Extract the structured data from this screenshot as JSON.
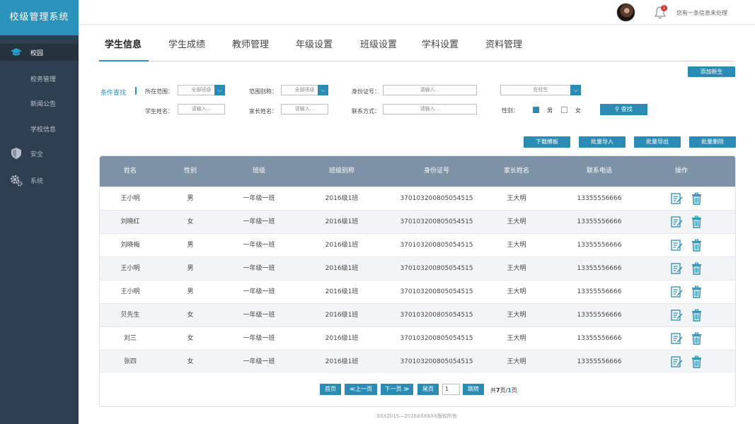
{
  "app": {
    "title": "校级管理系统"
  },
  "sidebar": {
    "items": [
      {
        "label": "校园",
        "icon": "graduation-cap-icon",
        "active": true
      },
      {
        "label": "校务管理"
      },
      {
        "label": "新闻公告"
      },
      {
        "label": "学校信息"
      },
      {
        "label": "安全",
        "icon": "shield-icon"
      },
      {
        "label": "系统",
        "icon": "gears-icon"
      }
    ]
  },
  "topbar": {
    "notification_count": "1",
    "notice_text": "您有一条信息未处理"
  },
  "tabs": [
    {
      "label": "学生信息",
      "active": true
    },
    {
      "label": "学生成绩"
    },
    {
      "label": "教师管理"
    },
    {
      "label": "年级设置"
    },
    {
      "label": "班级设置"
    },
    {
      "label": "学科设置"
    },
    {
      "label": "资料管理"
    }
  ],
  "add_button": "添加新生",
  "filters": {
    "title": "条件查找",
    "range_label": "所在范围：",
    "range_value": "全部班级",
    "alias_label": "范围别称：",
    "alias_value": "全部班级",
    "id_label": "身份证号：",
    "id_placeholder": "请输入...",
    "status_value": "在校生",
    "student_label": "学生姓名：",
    "student_placeholder": "请输入...",
    "parent_label": "家长姓名：",
    "parent_placeholder": "请输入...",
    "contact_label": "联系方式：",
    "contact_placeholder": "请输入...",
    "gender_label": "性别：",
    "gender_male": "男",
    "gender_female": "女",
    "search_button": "查找"
  },
  "actions": {
    "download": "下载模板",
    "import": "批量导入",
    "export": "批量导出",
    "delete": "批量删除"
  },
  "table": {
    "headers": [
      "姓名",
      "性别",
      "班级",
      "班级别称",
      "身份证号",
      "家长姓名",
      "联系电话",
      "操作"
    ],
    "rows": [
      [
        "王小明",
        "男",
        "一年级一班",
        "2016级1班",
        "370103200805054515",
        "王大明",
        "13355556666"
      ],
      [
        "刘晓红",
        "女",
        "一年级一班",
        "2016级1班",
        "370103200805054515",
        "王大明",
        "13355556666"
      ],
      [
        "刘晓梅",
        "男",
        "一年级一班",
        "2016级1班",
        "370103200805054515",
        "王大明",
        "13355556666"
      ],
      [
        "王小明",
        "男",
        "一年级一班",
        "2016级1班",
        "370103200805054515",
        "王大明",
        "13355556666"
      ],
      [
        "王小明",
        "男",
        "一年级一班",
        "2016级1班",
        "370103200805054515",
        "王大明",
        "13355556666"
      ],
      [
        "贝先生",
        "女",
        "一年级一班",
        "2016级1班",
        "370103200805054515",
        "王大明",
        "13355556666"
      ],
      [
        "刘三",
        "女",
        "一年级一班",
        "2016级1班",
        "370103200805054515",
        "王大明",
        "13355556666"
      ],
      [
        "张四",
        "女",
        "一年级一班",
        "2016级1班",
        "370103200805054515",
        "王大明",
        "13355556666"
      ]
    ]
  },
  "pager": {
    "first": "首页",
    "prev": "≪上一页",
    "next": "下一页 ≫",
    "last": "尾页",
    "page_value": "1",
    "jump": "跳转",
    "total_prefix": "共",
    "total_pages": "7",
    "total_mid": "页/",
    "current_page": "1",
    "total_suffix": "页"
  },
  "footer": "XXX2015—2016XXXXXX版权所有"
}
